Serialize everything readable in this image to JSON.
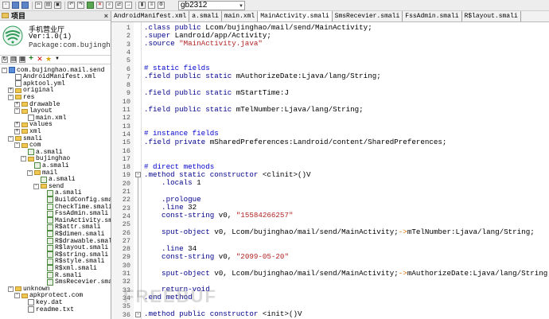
{
  "toolbar": {
    "font_name": "gb2312"
  },
  "project_panel": {
    "title": "项目",
    "close": "×",
    "app_name": "手机营业厅",
    "app_version": "Ver:1.0(1)",
    "app_package": "Package:com.bujinghao.mail"
  },
  "tree": [
    {
      "label": "com.bujinghao.mail.send",
      "indent": 0,
      "exp": "-",
      "icon": "pkg"
    },
    {
      "label": "AndroidManifest.xml",
      "indent": 1,
      "exp": "",
      "icon": "file"
    },
    {
      "label": "apktool.yml",
      "indent": 1,
      "exp": "",
      "icon": "file"
    },
    {
      "label": "original",
      "indent": 1,
      "exp": "+",
      "icon": "folder"
    },
    {
      "label": "res",
      "indent": 1,
      "exp": "-",
      "icon": "folder"
    },
    {
      "label": "drawable",
      "indent": 2,
      "exp": "+",
      "icon": "folder"
    },
    {
      "label": "layout",
      "indent": 2,
      "exp": "-",
      "icon": "folder"
    },
    {
      "label": "main.xml",
      "indent": 3,
      "exp": "",
      "icon": "file"
    },
    {
      "label": "values",
      "indent": 2,
      "exp": "+",
      "icon": "folder"
    },
    {
      "label": "xml",
      "indent": 2,
      "exp": "+",
      "icon": "folder"
    },
    {
      "label": "smali",
      "indent": 1,
      "exp": "-",
      "icon": "folder"
    },
    {
      "label": "com",
      "indent": 2,
      "exp": "-",
      "icon": "folder"
    },
    {
      "label": "a.smali",
      "indent": 3,
      "exp": "",
      "icon": "smali"
    },
    {
      "label": "bujinghao",
      "indent": 3,
      "exp": "-",
      "icon": "folder"
    },
    {
      "label": "a.smali",
      "indent": 4,
      "exp": "",
      "icon": "smali"
    },
    {
      "label": "mail",
      "indent": 4,
      "exp": "-",
      "icon": "folder"
    },
    {
      "label": "a.smali",
      "indent": 5,
      "exp": "",
      "icon": "smali"
    },
    {
      "label": "send",
      "indent": 5,
      "exp": "-",
      "icon": "folder"
    },
    {
      "label": "a.smali",
      "indent": 6,
      "exp": "",
      "icon": "smali"
    },
    {
      "label": "BuildConfig.smali",
      "indent": 6,
      "exp": "",
      "icon": "smali"
    },
    {
      "label": "CheckTime.smali",
      "indent": 6,
      "exp": "",
      "icon": "smali"
    },
    {
      "label": "FssAdmin.smali",
      "indent": 6,
      "exp": "",
      "icon": "smali"
    },
    {
      "label": "MainActivity.smali",
      "indent": 6,
      "exp": "",
      "icon": "smali"
    },
    {
      "label": "R$attr.smali",
      "indent": 6,
      "exp": "",
      "icon": "smali"
    },
    {
      "label": "R$dimen.smali",
      "indent": 6,
      "exp": "",
      "icon": "smali"
    },
    {
      "label": "R$drawable.smali",
      "indent": 6,
      "exp": "",
      "icon": "smali"
    },
    {
      "label": "R$layout.smali",
      "indent": 6,
      "exp": "",
      "icon": "smali"
    },
    {
      "label": "R$string.smali",
      "indent": 6,
      "exp": "",
      "icon": "smali"
    },
    {
      "label": "R$style.smali",
      "indent": 6,
      "exp": "",
      "icon": "smali"
    },
    {
      "label": "R$xml.smali",
      "indent": 6,
      "exp": "",
      "icon": "smali"
    },
    {
      "label": "R.smali",
      "indent": 6,
      "exp": "",
      "icon": "smali"
    },
    {
      "label": "SmsRecevier.smali",
      "indent": 6,
      "exp": "",
      "icon": "smali"
    },
    {
      "label": "unknown",
      "indent": 1,
      "exp": "-",
      "icon": "folder"
    },
    {
      "label": "apkprotect.com",
      "indent": 2,
      "exp": "-",
      "icon": "folder"
    },
    {
      "label": "key.dat",
      "indent": 3,
      "exp": "",
      "icon": "file"
    },
    {
      "label": "readme.txt",
      "indent": 3,
      "exp": "",
      "icon": "file"
    }
  ],
  "tabs": [
    {
      "label": "AndroidManifest.xml",
      "active": false
    },
    {
      "label": "a.smali",
      "active": false
    },
    {
      "label": "main.xml",
      "active": false
    },
    {
      "label": "MainActivity.smali",
      "active": true
    },
    {
      "label": "SmsRecevier.smali",
      "active": false
    },
    {
      "label": "FssAdmin.smali",
      "active": false
    },
    {
      "label": "R$layout.smali",
      "active": false
    }
  ],
  "code_lines": [
    {
      "n": "1",
      "segs": [
        [
          "kw",
          ".class public "
        ],
        [
          "prop",
          "Lcom/bujinghao/mail/send/MainActivity;"
        ]
      ]
    },
    {
      "n": "2",
      "segs": [
        [
          "kw",
          ".super "
        ],
        [
          "prop",
          "Landroid/app/Activity;"
        ]
      ]
    },
    {
      "n": "3",
      "segs": [
        [
          "kw",
          ".source "
        ],
        [
          "str",
          "\"MainActivity.java\""
        ]
      ]
    },
    {
      "n": "4",
      "segs": []
    },
    {
      "n": "5",
      "segs": []
    },
    {
      "n": "6",
      "segs": [
        [
          "cmt",
          "# static fields"
        ]
      ]
    },
    {
      "n": "7",
      "segs": [
        [
          "kw",
          ".field public static "
        ],
        [
          "prop",
          "mAuthorizeDate:Ljava/lang/String;"
        ]
      ]
    },
    {
      "n": "8",
      "segs": []
    },
    {
      "n": "9",
      "segs": [
        [
          "kw",
          ".field public static "
        ],
        [
          "prop",
          "mStartTime:J"
        ]
      ]
    },
    {
      "n": "10",
      "segs": []
    },
    {
      "n": "11",
      "segs": [
        [
          "kw",
          ".field public static "
        ],
        [
          "prop",
          "mTelNumber:Ljava/lang/String;"
        ]
      ]
    },
    {
      "n": "12",
      "segs": []
    },
    {
      "n": "13",
      "segs": []
    },
    {
      "n": "14",
      "segs": [
        [
          "cmt",
          "# instance fields"
        ]
      ]
    },
    {
      "n": "15",
      "segs": [
        [
          "kw",
          ".field private "
        ],
        [
          "prop",
          "mSharedPreferences:Landroid/content/SharedPreferences;"
        ]
      ]
    },
    {
      "n": "16",
      "segs": []
    },
    {
      "n": "17",
      "segs": []
    },
    {
      "n": "18",
      "segs": [
        [
          "cmt",
          "# direct methods"
        ]
      ]
    },
    {
      "n": "19",
      "segs": [
        [
          "kw",
          ".method static constructor "
        ],
        [
          "prop",
          "<clinit>()V"
        ]
      ]
    },
    {
      "n": "20",
      "segs": [
        [
          "kw",
          "    .locals "
        ],
        [
          "prop",
          "1"
        ]
      ]
    },
    {
      "n": "21",
      "segs": []
    },
    {
      "n": "22",
      "segs": [
        [
          "kw",
          "    .prologue"
        ]
      ]
    },
    {
      "n": "23",
      "segs": [
        [
          "kw",
          "    .line "
        ],
        [
          "prop",
          "32"
        ]
      ]
    },
    {
      "n": "24",
      "segs": [
        [
          "kw",
          "    const-string "
        ],
        [
          "prop",
          "v0, "
        ],
        [
          "str",
          "\"15584266257\""
        ]
      ]
    },
    {
      "n": "25",
      "segs": []
    },
    {
      "n": "26",
      "segs": [
        [
          "kw",
          "    sput-object "
        ],
        [
          "prop",
          "v0, Lcom/bujinghao/mail/send/MainActivity;"
        ],
        [
          "op",
          "->"
        ],
        [
          "prop",
          "mTelNumber:Ljava/lang/String;"
        ]
      ]
    },
    {
      "n": "27",
      "segs": []
    },
    {
      "n": "28",
      "segs": [
        [
          "kw",
          "    .line "
        ],
        [
          "prop",
          "34"
        ]
      ]
    },
    {
      "n": "29",
      "segs": [
        [
          "kw",
          "    const-string "
        ],
        [
          "prop",
          "v0, "
        ],
        [
          "str",
          "\"2099-05-20\""
        ]
      ]
    },
    {
      "n": "30",
      "segs": []
    },
    {
      "n": "31",
      "segs": [
        [
          "kw",
          "    sput-object "
        ],
        [
          "prop",
          "v0, Lcom/bujinghao/mail/send/MainActivity;"
        ],
        [
          "op",
          "->"
        ],
        [
          "prop",
          "mAuthorizeDate:Ljava/lang/String;"
        ]
      ]
    },
    {
      "n": "32",
      "segs": []
    },
    {
      "n": "33",
      "segs": [
        [
          "kw",
          "    return-void"
        ]
      ]
    },
    {
      "n": "34",
      "segs": [
        [
          "kw",
          ".end method"
        ]
      ]
    },
    {
      "n": "35",
      "segs": []
    },
    {
      "n": "36",
      "segs": [
        [
          "kw",
          ".method public constructor "
        ],
        [
          "prop",
          "<init>()V"
        ]
      ]
    }
  ],
  "watermark": "FREEBUF"
}
